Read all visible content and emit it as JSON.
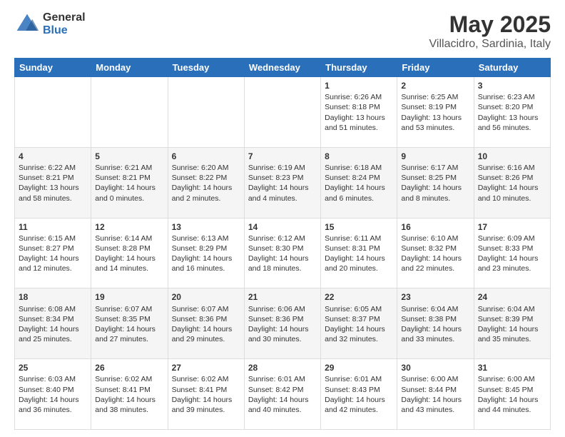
{
  "header": {
    "logo_general": "General",
    "logo_blue": "Blue",
    "month": "May 2025",
    "location": "Villacidro, Sardinia, Italy"
  },
  "days_of_week": [
    "Sunday",
    "Monday",
    "Tuesday",
    "Wednesday",
    "Thursday",
    "Friday",
    "Saturday"
  ],
  "weeks": [
    [
      {
        "day": "",
        "info": ""
      },
      {
        "day": "",
        "info": ""
      },
      {
        "day": "",
        "info": ""
      },
      {
        "day": "",
        "info": ""
      },
      {
        "day": "1",
        "info": "Sunrise: 6:26 AM\nSunset: 8:18 PM\nDaylight: 13 hours\nand 51 minutes."
      },
      {
        "day": "2",
        "info": "Sunrise: 6:25 AM\nSunset: 8:19 PM\nDaylight: 13 hours\nand 53 minutes."
      },
      {
        "day": "3",
        "info": "Sunrise: 6:23 AM\nSunset: 8:20 PM\nDaylight: 13 hours\nand 56 minutes."
      }
    ],
    [
      {
        "day": "4",
        "info": "Sunrise: 6:22 AM\nSunset: 8:21 PM\nDaylight: 13 hours\nand 58 minutes."
      },
      {
        "day": "5",
        "info": "Sunrise: 6:21 AM\nSunset: 8:21 PM\nDaylight: 14 hours\nand 0 minutes."
      },
      {
        "day": "6",
        "info": "Sunrise: 6:20 AM\nSunset: 8:22 PM\nDaylight: 14 hours\nand 2 minutes."
      },
      {
        "day": "7",
        "info": "Sunrise: 6:19 AM\nSunset: 8:23 PM\nDaylight: 14 hours\nand 4 minutes."
      },
      {
        "day": "8",
        "info": "Sunrise: 6:18 AM\nSunset: 8:24 PM\nDaylight: 14 hours\nand 6 minutes."
      },
      {
        "day": "9",
        "info": "Sunrise: 6:17 AM\nSunset: 8:25 PM\nDaylight: 14 hours\nand 8 minutes."
      },
      {
        "day": "10",
        "info": "Sunrise: 6:16 AM\nSunset: 8:26 PM\nDaylight: 14 hours\nand 10 minutes."
      }
    ],
    [
      {
        "day": "11",
        "info": "Sunrise: 6:15 AM\nSunset: 8:27 PM\nDaylight: 14 hours\nand 12 minutes."
      },
      {
        "day": "12",
        "info": "Sunrise: 6:14 AM\nSunset: 8:28 PM\nDaylight: 14 hours\nand 14 minutes."
      },
      {
        "day": "13",
        "info": "Sunrise: 6:13 AM\nSunset: 8:29 PM\nDaylight: 14 hours\nand 16 minutes."
      },
      {
        "day": "14",
        "info": "Sunrise: 6:12 AM\nSunset: 8:30 PM\nDaylight: 14 hours\nand 18 minutes."
      },
      {
        "day": "15",
        "info": "Sunrise: 6:11 AM\nSunset: 8:31 PM\nDaylight: 14 hours\nand 20 minutes."
      },
      {
        "day": "16",
        "info": "Sunrise: 6:10 AM\nSunset: 8:32 PM\nDaylight: 14 hours\nand 22 minutes."
      },
      {
        "day": "17",
        "info": "Sunrise: 6:09 AM\nSunset: 8:33 PM\nDaylight: 14 hours\nand 23 minutes."
      }
    ],
    [
      {
        "day": "18",
        "info": "Sunrise: 6:08 AM\nSunset: 8:34 PM\nDaylight: 14 hours\nand 25 minutes."
      },
      {
        "day": "19",
        "info": "Sunrise: 6:07 AM\nSunset: 8:35 PM\nDaylight: 14 hours\nand 27 minutes."
      },
      {
        "day": "20",
        "info": "Sunrise: 6:07 AM\nSunset: 8:36 PM\nDaylight: 14 hours\nand 29 minutes."
      },
      {
        "day": "21",
        "info": "Sunrise: 6:06 AM\nSunset: 8:36 PM\nDaylight: 14 hours\nand 30 minutes."
      },
      {
        "day": "22",
        "info": "Sunrise: 6:05 AM\nSunset: 8:37 PM\nDaylight: 14 hours\nand 32 minutes."
      },
      {
        "day": "23",
        "info": "Sunrise: 6:04 AM\nSunset: 8:38 PM\nDaylight: 14 hours\nand 33 minutes."
      },
      {
        "day": "24",
        "info": "Sunrise: 6:04 AM\nSunset: 8:39 PM\nDaylight: 14 hours\nand 35 minutes."
      }
    ],
    [
      {
        "day": "25",
        "info": "Sunrise: 6:03 AM\nSunset: 8:40 PM\nDaylight: 14 hours\nand 36 minutes."
      },
      {
        "day": "26",
        "info": "Sunrise: 6:02 AM\nSunset: 8:41 PM\nDaylight: 14 hours\nand 38 minutes."
      },
      {
        "day": "27",
        "info": "Sunrise: 6:02 AM\nSunset: 8:41 PM\nDaylight: 14 hours\nand 39 minutes."
      },
      {
        "day": "28",
        "info": "Sunrise: 6:01 AM\nSunset: 8:42 PM\nDaylight: 14 hours\nand 40 minutes."
      },
      {
        "day": "29",
        "info": "Sunrise: 6:01 AM\nSunset: 8:43 PM\nDaylight: 14 hours\nand 42 minutes."
      },
      {
        "day": "30",
        "info": "Sunrise: 6:00 AM\nSunset: 8:44 PM\nDaylight: 14 hours\nand 43 minutes."
      },
      {
        "day": "31",
        "info": "Sunrise: 6:00 AM\nSunset: 8:45 PM\nDaylight: 14 hours\nand 44 minutes."
      }
    ]
  ]
}
